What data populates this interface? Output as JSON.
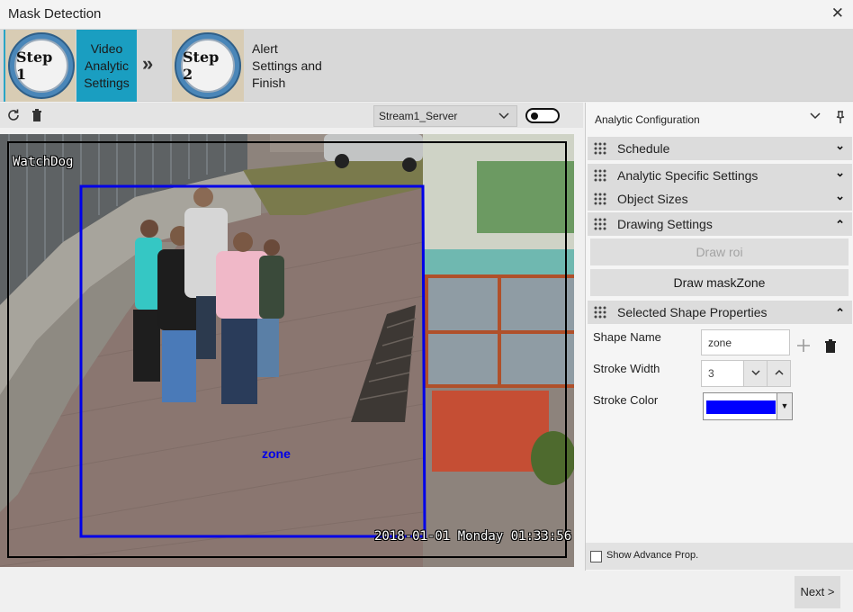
{
  "window": {
    "title": "Mask Detection",
    "close_symbol": "✕"
  },
  "wizard": {
    "steps": [
      {
        "badge": "Step 1",
        "label": "Video Analytic Settings",
        "active": true
      },
      {
        "badge": "Step 2",
        "label": "Alert Settings and Finish",
        "active": false
      }
    ],
    "separator": "»"
  },
  "toolbar": {
    "icons": [
      "refresh-icon",
      "trash-icon"
    ],
    "stream": {
      "selected": "Stream1_Server"
    },
    "toggle_on": false
  },
  "video": {
    "camera_label": "WatchDog",
    "timestamp": "2018-01-01 Monday 01:33:56",
    "zone_label": "zone",
    "zone_color": "#0000e8"
  },
  "panel": {
    "title": "Analytic Configuration",
    "sections": [
      {
        "label": "Schedule",
        "expanded": false
      },
      {
        "label": "Analytic Specific Settings",
        "expanded": false
      },
      {
        "label": "Object Sizes",
        "expanded": false
      },
      {
        "label": "Drawing Settings",
        "expanded": true
      },
      {
        "label": "Selected Shape Properties",
        "expanded": true
      }
    ],
    "drawing": {
      "draw_roi": "Draw roi",
      "draw_mask_zone": "Draw maskZone"
    },
    "shape": {
      "name_label": "Shape Name",
      "name_value": "zone",
      "stroke_width_label": "Stroke Width",
      "stroke_width_value": "3",
      "stroke_color_label": "Stroke Color",
      "stroke_color_value": "#0000ff"
    },
    "advanced": {
      "label": "Show Advance Prop.",
      "checked": false
    }
  },
  "footer": {
    "next_label": "Next >"
  },
  "colors": {
    "accent": "#1a9ec1",
    "section_bg": "#dcdcdc"
  }
}
